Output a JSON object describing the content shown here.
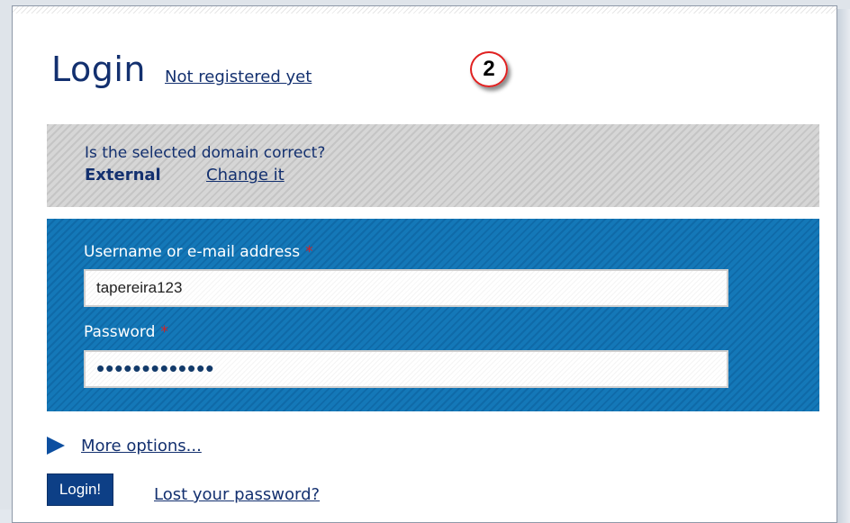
{
  "header": {
    "title": "Login",
    "register_link": "Not registered yet",
    "step_badge": "2"
  },
  "domain": {
    "question": "Is the selected domain correct?",
    "name": "External",
    "change_link": "Change it"
  },
  "form": {
    "username_label": "Username or e-mail address",
    "username_value": "tapereira123",
    "password_label": "Password",
    "password_mask": "•••••••••••••",
    "required_marker": "*"
  },
  "options": {
    "more_options": "More options..."
  },
  "actions": {
    "login_button": "Login!",
    "lost_password": "Lost your password?"
  },
  "colors": {
    "title": "#13306f",
    "credentials_bg": "#1478b8",
    "domain_bg": "#d6d6d6",
    "button_bg": "#0d3f86",
    "required": "#d82020",
    "badge_border": "#e02020"
  }
}
